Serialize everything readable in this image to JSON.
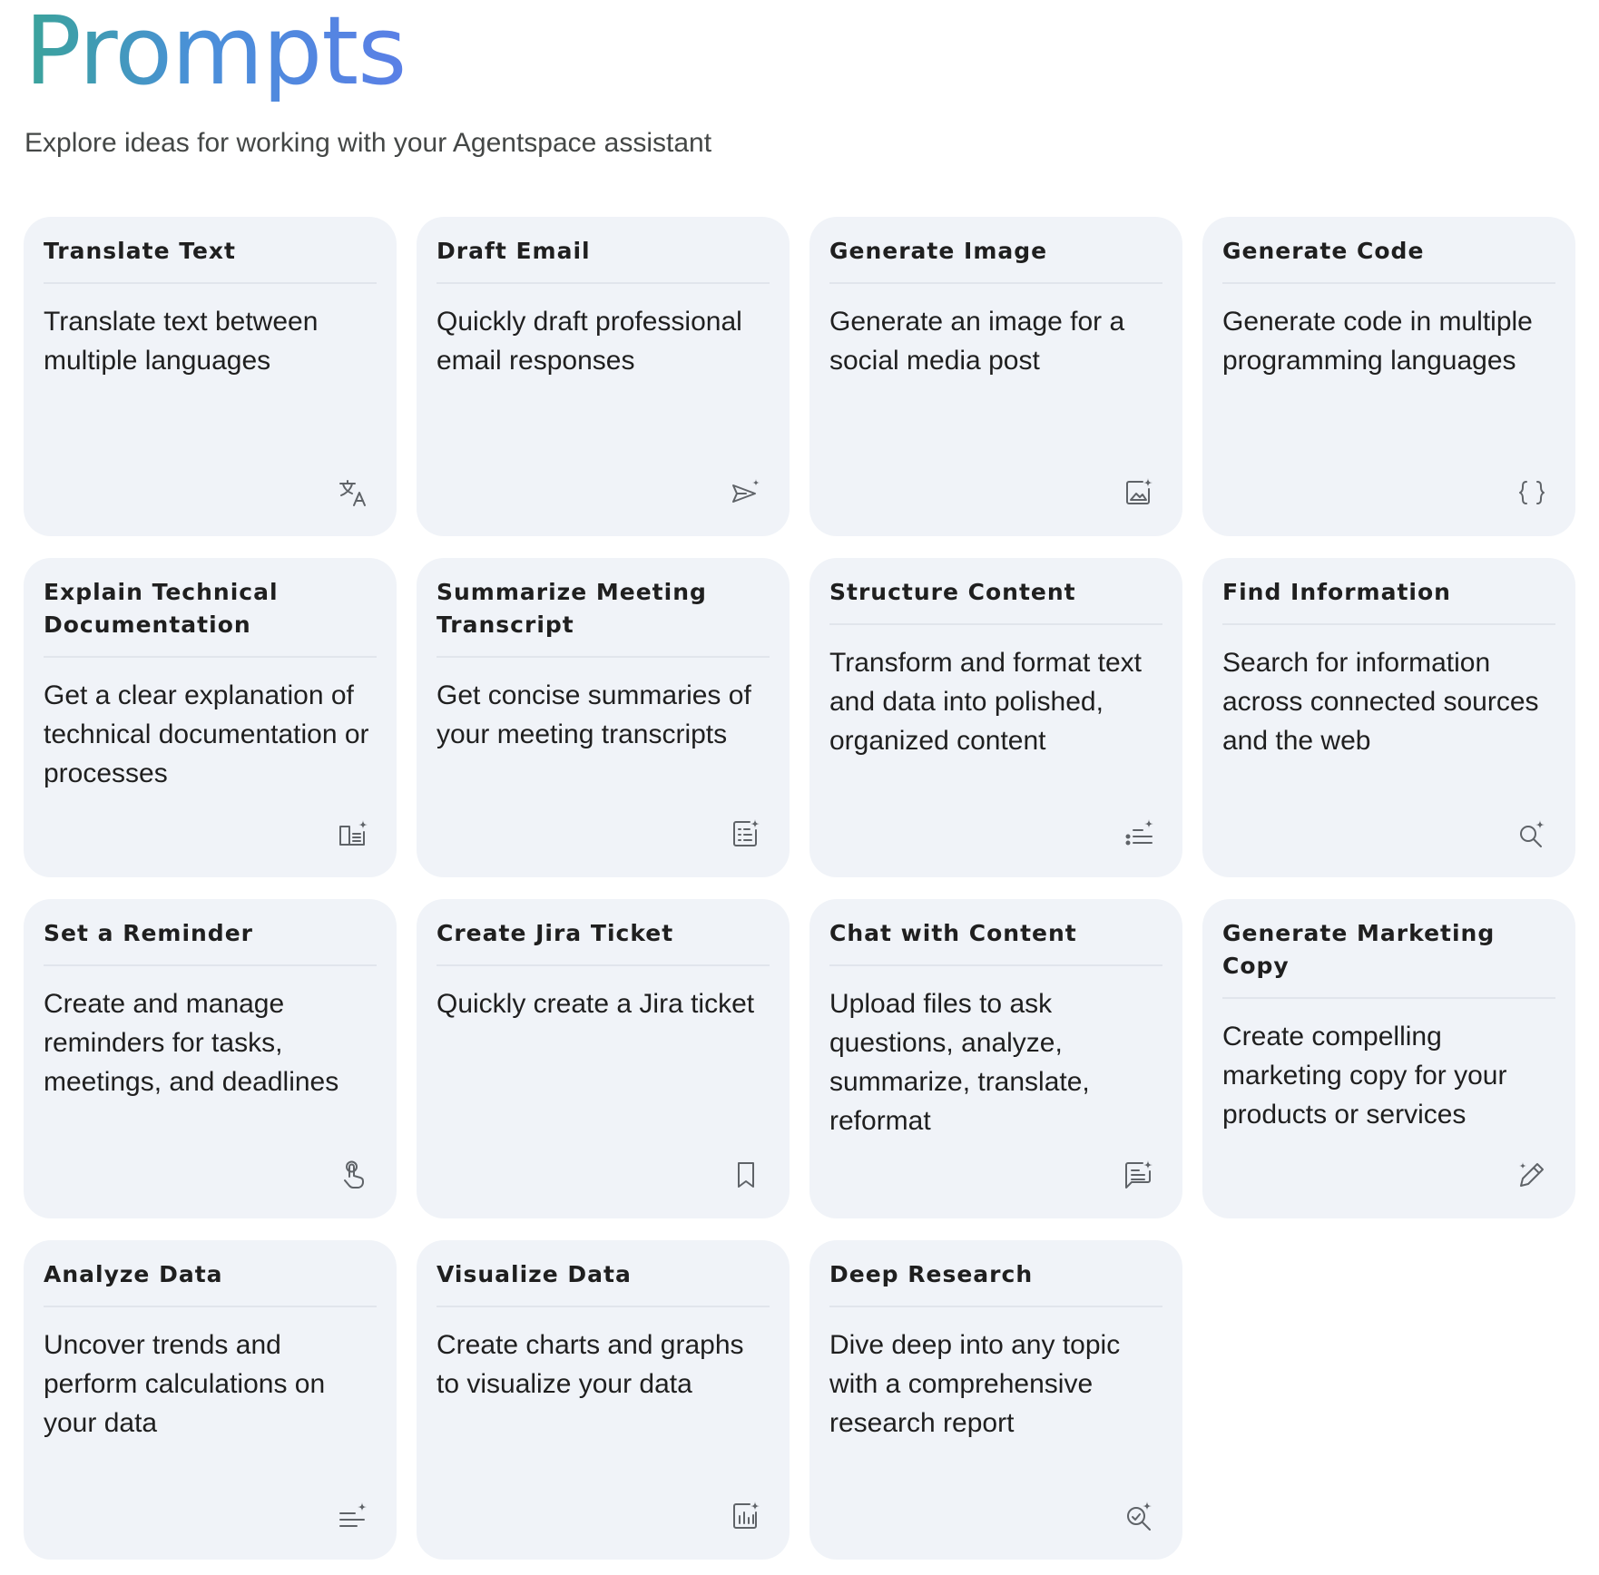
{
  "header": {
    "title": "Prompts",
    "subtitle": "Explore ideas for working with your Agentspace assistant"
  },
  "colors": {
    "title_gradient_start": "#3aa39a",
    "title_gradient_end": "#5a7fe6",
    "card_background": "#f0f3f8",
    "icon": "#5f6368"
  },
  "cards": [
    {
      "title": "Translate Text",
      "description": "Translate text between multiple languages",
      "icon": "translate-icon"
    },
    {
      "title": "Draft Email",
      "description": "Quickly draft professional email responses",
      "icon": "send-sparkle-icon"
    },
    {
      "title": "Generate Image",
      "description": "Generate an image for a social media post",
      "icon": "image-sparkle-icon"
    },
    {
      "title": "Generate Code",
      "description": "Generate code in multiple programming languages",
      "icon": "code-braces-icon"
    },
    {
      "title": "Explain Technical Documentation",
      "description": "Get a clear explanation of technical documentation or processes",
      "icon": "book-sparkle-icon"
    },
    {
      "title": "Summarize Meeting Transcript",
      "description": "Get concise summaries of your meeting transcripts",
      "icon": "summary-sparkle-icon"
    },
    {
      "title": "Structure Content",
      "description": "Transform and format text and data into polished, organized content",
      "icon": "list-sparkle-icon"
    },
    {
      "title": "Find Information",
      "description": "Search for information across connected sources and the web",
      "icon": "search-sparkle-icon"
    },
    {
      "title": "Set a Reminder",
      "description": "Create and manage reminders for tasks, meetings, and deadlines",
      "icon": "touch-reminder-icon"
    },
    {
      "title": "Create Jira Ticket",
      "description": "Quickly create a Jira ticket",
      "icon": "bookmark-icon"
    },
    {
      "title": "Chat with Content",
      "description": "Upload files to ask questions, analyze, summarize, translate, reformat",
      "icon": "chat-sparkle-icon"
    },
    {
      "title": "Generate Marketing Copy",
      "description": "Create compelling marketing copy for your products or services",
      "icon": "pen-sparkle-icon"
    },
    {
      "title": "Analyze Data",
      "description": "Uncover trends and perform calculations on your data",
      "icon": "lines-sparkle-icon"
    },
    {
      "title": "Visualize Data",
      "description": "Create charts and graphs to visualize your data",
      "icon": "chart-sparkle-icon"
    },
    {
      "title": "Deep Research",
      "description": "Dive deep into any topic with a comprehensive research report",
      "icon": "research-sparkle-icon"
    }
  ]
}
